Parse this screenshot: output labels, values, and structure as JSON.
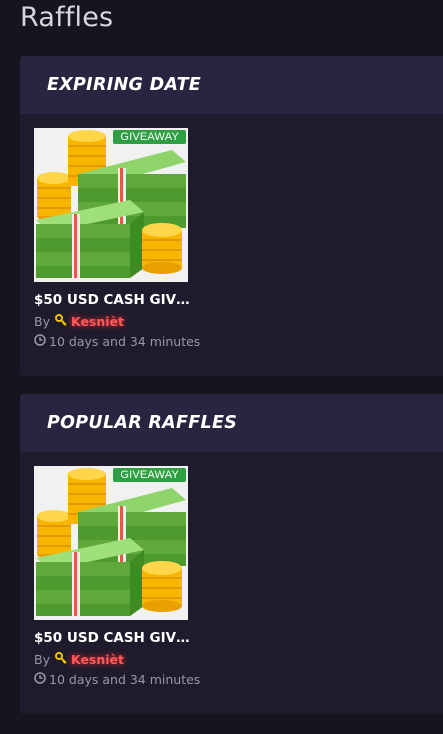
{
  "page": {
    "title": "Raffles"
  },
  "sections": [
    {
      "heading": "EXPIRING DATE",
      "card": {
        "badge": "GIVEAWAY",
        "title": "$50 USD CASH GIVE...",
        "by_label": "By",
        "author": "Kesnièt",
        "time": "10 days and 34 minutes"
      }
    },
    {
      "heading": "POPULAR RAFFLES",
      "card": {
        "badge": "GIVEAWAY",
        "title": "$50 USD CASH GIVE...",
        "by_label": "By",
        "author": "Kesnièt",
        "time": "10 days and 34 minutes"
      }
    }
  ],
  "colors": {
    "background": "#17141f",
    "panel": "#1f1b2c",
    "panel_header": "#2a2440",
    "badge": "#2ea043",
    "author": "#ff5a5a"
  },
  "icons": {
    "author_badge": "key-icon",
    "time": "clock-icon",
    "thumbnail": "cash-money-image"
  }
}
